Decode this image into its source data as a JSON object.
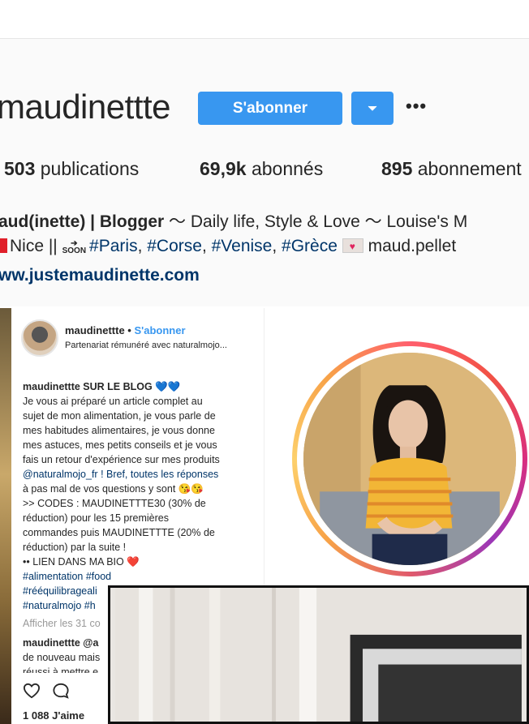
{
  "profile": {
    "username": "maudinettte",
    "follow_label": "S'abonner",
    "more_label": "•••",
    "stats": {
      "posts_count": "503",
      "posts_label": "publications",
      "followers_count": "69,9k",
      "followers_label": "abonnés",
      "following_count": "895",
      "following_label": "abonnement"
    },
    "bio": {
      "line1_bold": "aud(inette) | Blogger",
      "line1_rest": " 〜 Daily life, Style & Love 〜 Louise's M",
      "line2_prefix": "Nice || ",
      "line2_tags": [
        "#Paris",
        "#Corse",
        "#Venise",
        "#Grèce"
      ],
      "line2_suffix": " maud.pellet",
      "link": "ww.justemaudinette.com"
    }
  },
  "post": {
    "username": "maudinettte",
    "dot": " • ",
    "follow_label": "S'abonner",
    "partner_label": "Partenariat rémunéré avec naturalmojo...",
    "caption_lines": [
      "maudinettte SUR LE BLOG 💙💙",
      "Je vous ai préparé un article complet au",
      "sujet de mon alimentation, je vous parle de",
      "mes habitudes alimentaires, je vous donne",
      "mes astuces, mes petits conseils et je vous",
      "fais un retour d'expérience sur mes produits",
      "@naturalmojo_fr ! Bref, toutes les réponses",
      "à pas mal de vos questions y sont 😘😘",
      ">> CODES : MAUDINETTTE30 (30% de",
      "réduction) pour les 15 premières",
      "commandes puis MAUDINETTTE (20% de",
      "réduction) par la suite !",
      "•• LIEN DANS MA BIO ❤️",
      "#alimentation #food",
      "#rééquilibrageali",
      "#naturalmojo #h"
    ],
    "show_comments": "Afficher les 31 co",
    "comment_user": "maudinettte @a",
    "comment_line2": "de nouveau mais",
    "comment_line3": "réussi à mettre e",
    "likes": "1 088 J'aime"
  },
  "colors": {
    "accent": "#3897f0",
    "link": "#003569",
    "text": "#262626"
  }
}
